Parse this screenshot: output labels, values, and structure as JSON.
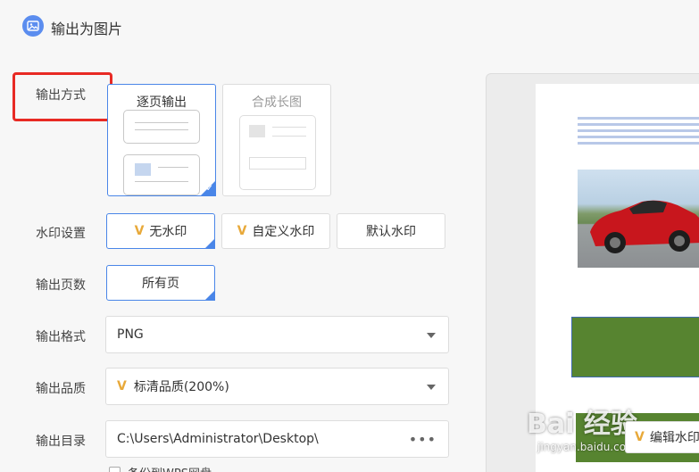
{
  "header": {
    "title": "输出为图片",
    "icon": "image-icon"
  },
  "labels": {
    "mode": "输出方式",
    "watermark": "水印设置",
    "pages": "输出页数",
    "format": "输出格式",
    "quality": "输出品质",
    "directory": "输出目录"
  },
  "mode_options": [
    {
      "label": "逐页输出",
      "selected": true
    },
    {
      "label": "合成长图",
      "selected": false
    }
  ],
  "watermark_options": [
    {
      "label": "无水印",
      "vip": true,
      "selected": true
    },
    {
      "label": "自定义水印",
      "vip": true,
      "selected": false
    },
    {
      "label": "默认水印",
      "vip": false,
      "selected": false
    }
  ],
  "pages_option": {
    "label": "所有页",
    "selected": true
  },
  "format": {
    "value": "PNG"
  },
  "quality": {
    "value": "标清品质(200%)",
    "vip": true
  },
  "directory": {
    "value": "C:\\Users\\Administrator\\Desktop\\",
    "more": "•••"
  },
  "backup": {
    "label": "备份到WPS网盘",
    "checked": false
  },
  "preview": {
    "edit_watermark_label": "编辑水印",
    "site_watermark": "Bai 经验",
    "site_sub": "jingyan.baidu.com"
  },
  "colors": {
    "accent": "#4a86e8",
    "vip": "#e8a93a",
    "highlight": "#e82a24"
  }
}
